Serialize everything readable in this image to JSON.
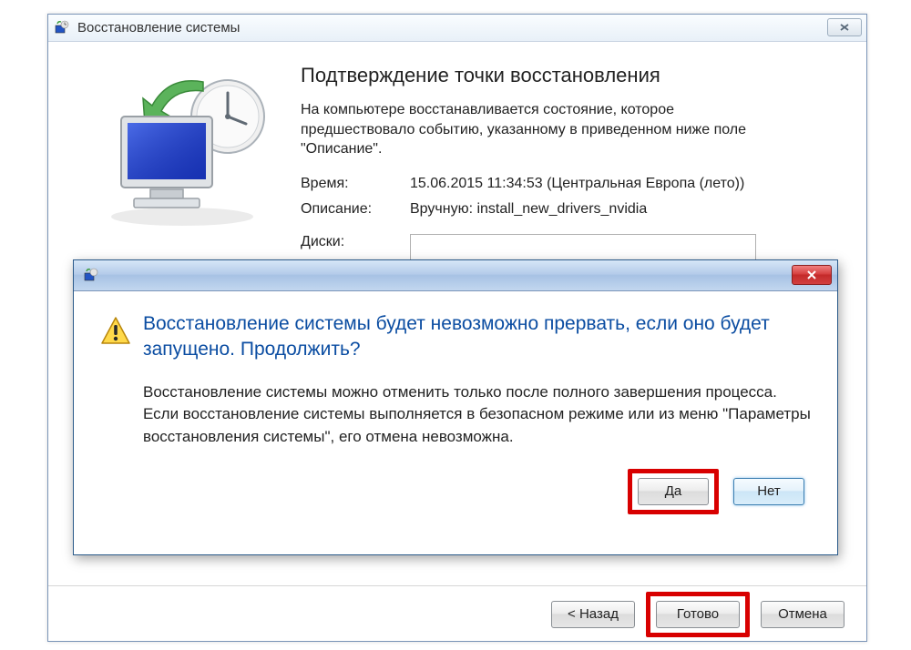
{
  "main": {
    "title": "Восстановление системы",
    "heading": "Подтверждение точки восстановления",
    "description": "На компьютере восстанавливается состояние, которое предшествовало событию, указанному в приведенном ниже поле \"Описание\".",
    "time_label": "Время:",
    "time_value": "15.06.2015 11:34:53 (Центральная Европа (лето))",
    "desc_label": "Описание:",
    "desc_value": "Вручную: install_new_drivers_nvidia",
    "disks_label": "Диски:",
    "buttons": {
      "back": "< Назад",
      "finish": "Готово",
      "cancel": "Отмена"
    }
  },
  "modal": {
    "headline": "Восстановление системы будет невозможно прервать, если оно будет запущено. Продолжить?",
    "paragraph": "Восстановление системы можно отменить только после полного завершения процесса. Если восстановление системы выполняется в безопасном режиме или из меню \"Параметры восстановления системы\", его отмена невозможна.",
    "yes": "Да",
    "no": "Нет"
  }
}
